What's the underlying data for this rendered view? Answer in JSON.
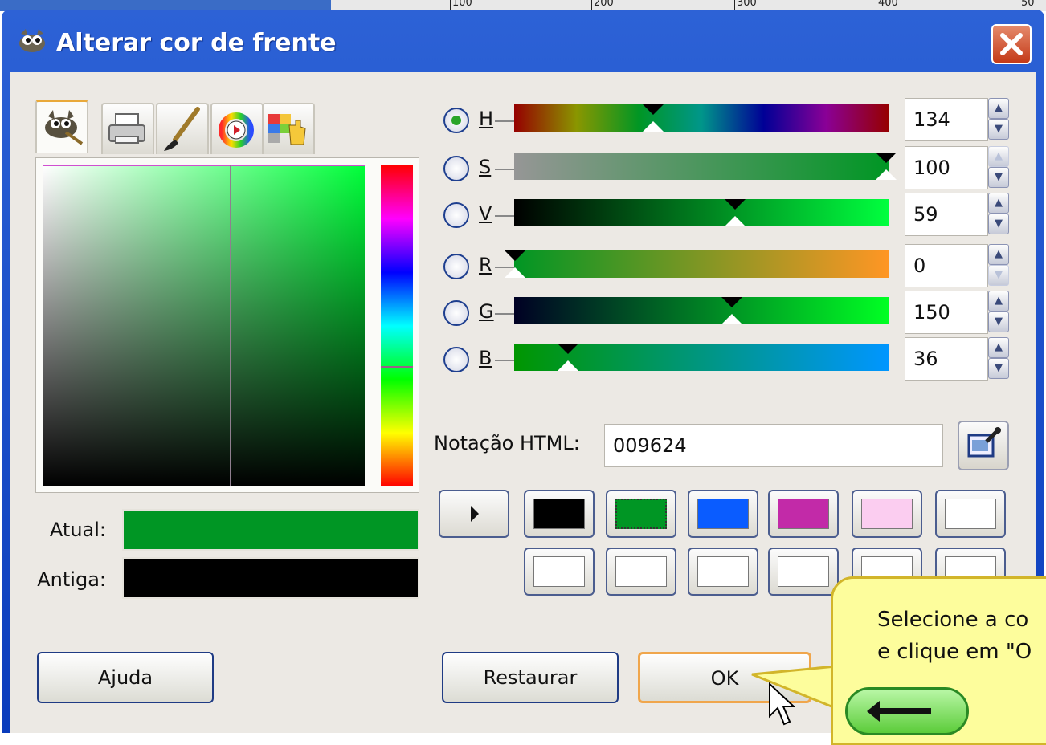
{
  "window": {
    "title": "Alterar cor de frente"
  },
  "background": {
    "ruler_ticks": [
      "100",
      "200",
      "300",
      "400",
      "50"
    ]
  },
  "tabs": [
    {
      "name": "gimp-selector",
      "icon": "wilber-icon",
      "active": true
    },
    {
      "name": "cmyk",
      "icon": "printer-icon",
      "active": false
    },
    {
      "name": "watercolor",
      "icon": "brush-icon",
      "active": false
    },
    {
      "name": "wheel",
      "icon": "color-wheel-icon",
      "active": false
    },
    {
      "name": "palette",
      "icon": "palette-hand-icon",
      "active": false
    }
  ],
  "swatches": {
    "current_label": "Atual:",
    "old_label": "Antiga:",
    "current_color": "#009624",
    "old_color": "#000000"
  },
  "channels": [
    {
      "key": "H",
      "value": "134",
      "selected": true
    },
    {
      "key": "S",
      "value": "100",
      "selected": false
    },
    {
      "key": "V",
      "value": "59",
      "selected": false
    },
    {
      "key": "R",
      "value": "0",
      "selected": false
    },
    {
      "key": "G",
      "value": "150",
      "selected": false
    },
    {
      "key": "B",
      "value": "36",
      "selected": false
    }
  ],
  "html_notation": {
    "label": "Notação HTML:",
    "value": "009624"
  },
  "history": {
    "row1": [
      "#000000",
      "#009624",
      "#0a5cff",
      "#c22aa8",
      "#fbcdf0",
      "#ffffff"
    ],
    "row2": [
      "#ffffff",
      "#ffffff",
      "#ffffff",
      "#ffffff",
      "#ffffff",
      "#ffffff"
    ]
  },
  "buttons": {
    "help": "Ajuda",
    "reset": "Restaurar",
    "ok": "OK"
  },
  "callout": {
    "line1": "Selecione a co",
    "line2": "e clique em \"O"
  },
  "colors": {
    "titlebar": "#0a3cbc",
    "client_bg": "#ece9e4",
    "ok_border": "#f0a64c",
    "callout_bg": "#fdfd9c"
  }
}
